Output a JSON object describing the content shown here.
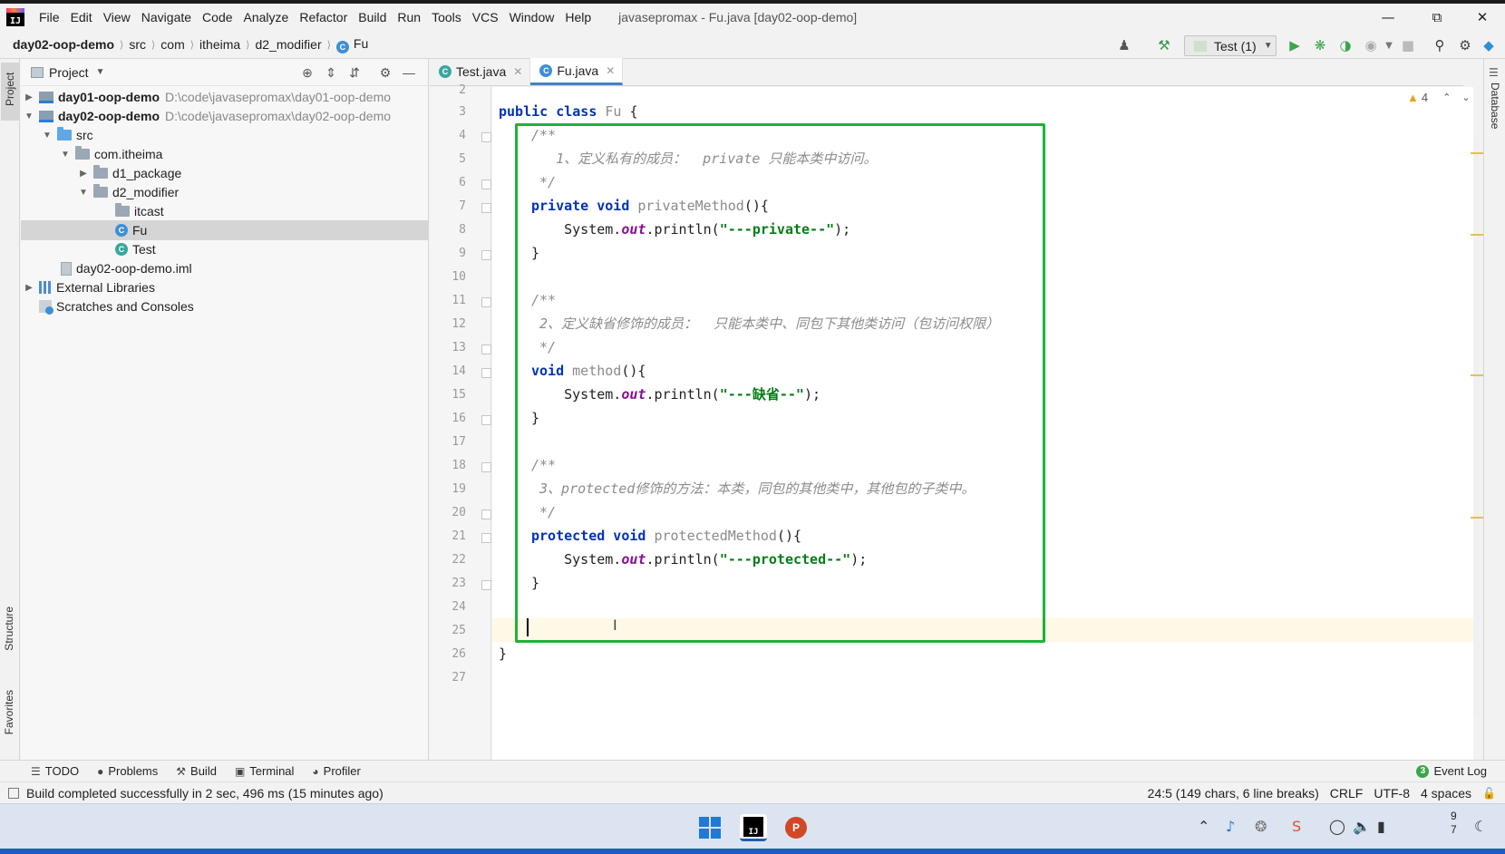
{
  "menubar": {
    "items": [
      "File",
      "Edit",
      "View",
      "Navigate",
      "Code",
      "Analyze",
      "Refactor",
      "Build",
      "Run",
      "Tools",
      "VCS",
      "Window",
      "Help"
    ],
    "window_title": "javasepromax - Fu.java [day02-oop-demo]"
  },
  "breadcrumb": {
    "items": [
      "day02-oop-demo",
      "src",
      "com",
      "itheima",
      "d2_modifier",
      "Fu"
    ]
  },
  "toolbar": {
    "run_config": "Test (1)"
  },
  "left_strip": {
    "project_label": "Project",
    "structure_label": "Structure",
    "favorites_label": "Favorites"
  },
  "right_strip": {
    "database_label": "Database"
  },
  "project_panel": {
    "title": "Project",
    "tree": [
      {
        "label": "day01-oop-demo",
        "path": "D:\\code\\javasepromax\\day01-oop-demo"
      },
      {
        "label": "day02-oop-demo",
        "path": "D:\\code\\javasepromax\\day02-oop-demo"
      },
      {
        "label": "src"
      },
      {
        "label": "com.itheima"
      },
      {
        "label": "d1_package"
      },
      {
        "label": "d2_modifier"
      },
      {
        "label": "itcast"
      },
      {
        "label": "Fu"
      },
      {
        "label": "Test"
      },
      {
        "label": "day02-oop-demo.iml"
      },
      {
        "label": "External Libraries"
      },
      {
        "label": "Scratches and Consoles"
      }
    ]
  },
  "editor": {
    "tabs": [
      {
        "label": "Test.java",
        "active": false
      },
      {
        "label": "Fu.java",
        "active": true
      }
    ],
    "warning_count": "4",
    "line_numbers": [
      "2",
      "3",
      "4",
      "5",
      "6",
      "7",
      "8",
      "9",
      "10",
      "11",
      "12",
      "13",
      "14",
      "15",
      "16",
      "17",
      "18",
      "19",
      "20",
      "21",
      "22",
      "23",
      "24",
      "25",
      "26",
      "27"
    ],
    "code": {
      "l3_kw": "public class ",
      "l3_cls": "Fu",
      "l3_rest": " {",
      "l4": "/**",
      "l5": "   1、定义私有的成员：  private 只能本类中访问。",
      "l6": " */",
      "l7_kw": "private void ",
      "l7_m": "privateMethod",
      "l7_rest": "(){",
      "l8_a": "    System.",
      "l8_out": "out",
      "l8_b": ".println(",
      "l8_str": "\"---private--\"",
      "l8_c": ");",
      "l9": "}",
      "l11": "/**",
      "l12": " 2、定义缺省修饰的成员：  只能本类中、同包下其他类访问（包访问权限）",
      "l13": " */",
      "l14_kw": "void ",
      "l14_m": "method",
      "l14_rest": "(){",
      "l15_a": "    System.",
      "l15_out": "out",
      "l15_b": ".println(",
      "l15_str": "\"---缺省--\"",
      "l15_c": ");",
      "l16": "}",
      "l18": "/**",
      "l19": " 3、protected修饰的方法：本类，同包的其他类中，其他包的子类中。",
      "l20": " */",
      "l21_kw": "protected void ",
      "l21_m": "protectedMethod",
      "l21_rest": "(){",
      "l22_a": "    System.",
      "l22_out": "out",
      "l22_b": ".println(",
      "l22_str": "\"---protected--\"",
      "l22_c": ");",
      "l23": "}",
      "l26": "}"
    }
  },
  "bottom_tabs": {
    "todo": "TODO",
    "problems": "Problems",
    "build": "Build",
    "terminal": "Terminal",
    "profiler": "Profiler",
    "event_log": "Event Log",
    "event_log_count": "3"
  },
  "statusbar": {
    "message": "Build completed successfully in 2 sec, 496 ms (15 minutes ago)",
    "position": "24:5 (149 chars, 6 line breaks)",
    "line_sep": "CRLF",
    "encoding": "UTF-8",
    "indent": "4 spaces"
  },
  "taskbar": {
    "clock_line1": "9",
    "clock_line2": "7"
  },
  "colors": {
    "highlight_box": "#1fb138",
    "keyword": "#0033b3",
    "string": "#067d17",
    "field": "#871094",
    "comment": "#8c8c8c",
    "accent": "#4083c9"
  }
}
